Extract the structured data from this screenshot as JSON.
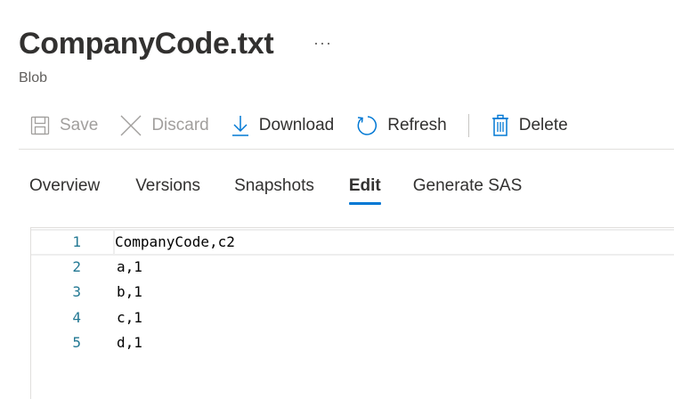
{
  "header": {
    "title": "CompanyCode.txt",
    "more": "···",
    "subtitle": "Blob"
  },
  "toolbar": {
    "save": "Save",
    "discard": "Discard",
    "download": "Download",
    "refresh": "Refresh",
    "delete": "Delete"
  },
  "tabs": [
    {
      "label": "Overview"
    },
    {
      "label": "Versions"
    },
    {
      "label": "Snapshots"
    },
    {
      "label": "Edit"
    },
    {
      "label": "Generate SAS"
    }
  ],
  "active_tab": "Edit",
  "editor": {
    "lines": [
      {
        "num": "1",
        "text": "CompanyCode,c2"
      },
      {
        "num": "2",
        "text": "a,1"
      },
      {
        "num": "3",
        "text": "b,1"
      },
      {
        "num": "4",
        "text": "c,1"
      },
      {
        "num": "5",
        "text": "d,1"
      }
    ]
  },
  "colors": {
    "accent": "#0078d4",
    "line_number": "#237893",
    "disabled": "#a19f9d"
  }
}
